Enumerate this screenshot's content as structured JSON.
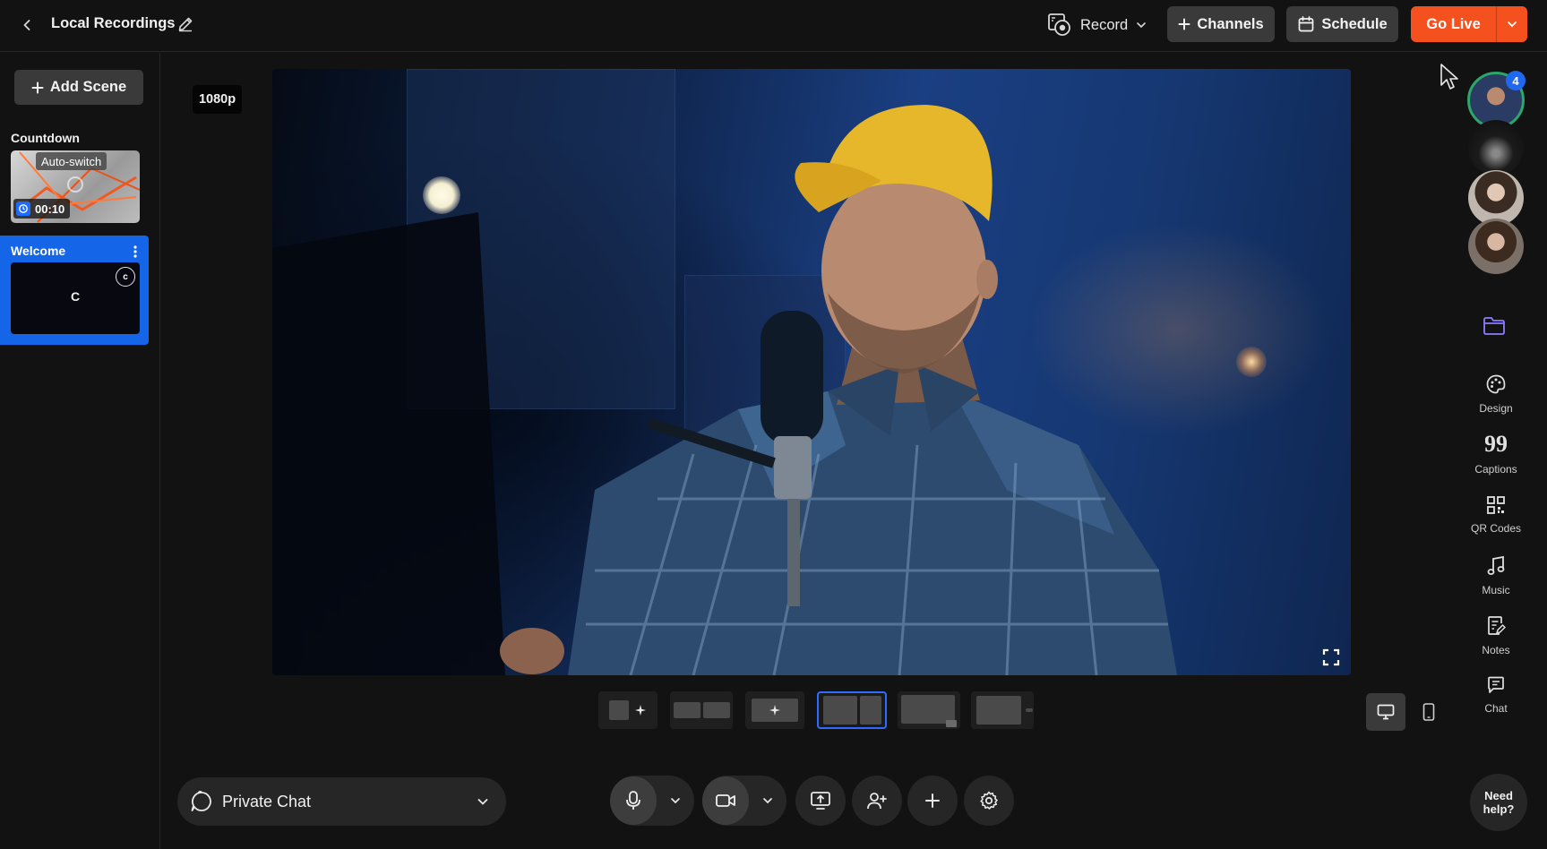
{
  "header": {
    "back_icon": "chevron-left-icon",
    "title": "Local Recordings",
    "edit_icon": "pencil-icon",
    "record_label": "Record",
    "channels_label": "Channels",
    "schedule_label": "Schedule",
    "golive_label": "Go Live",
    "accent_color": "#f4511e"
  },
  "sidebar": {
    "add_scene_label": "Add Scene",
    "scenes": [
      {
        "name": "Countdown",
        "badge": "Auto-switch",
        "timer": "00:10"
      },
      {
        "name": "Welcome",
        "thumb_letter": "C",
        "badge_letter": "c",
        "selected": true
      }
    ],
    "selected_color": "#1565e8"
  },
  "stage": {
    "resolution": "1080p",
    "fullscreen_icon": "fullscreen-icon"
  },
  "layouts": {
    "count": 6,
    "selected_index": 3
  },
  "view": {
    "desktop_icon": "monitor-icon",
    "mobile_icon": "phone-icon"
  },
  "participants": {
    "count_badge": "4"
  },
  "rail": {
    "items": [
      {
        "label": "Design",
        "icon": "palette-icon"
      },
      {
        "label": "Captions",
        "icon": "captions-icon"
      },
      {
        "label": "QR Codes",
        "icon": "qr-code-icon"
      },
      {
        "label": "Music",
        "icon": "music-icon"
      },
      {
        "label": "Notes",
        "icon": "notes-icon"
      },
      {
        "label": "Chat",
        "icon": "chat-icon"
      }
    ],
    "help_label": "Need help?"
  },
  "controls": {
    "private_chat_label": "Private Chat"
  }
}
